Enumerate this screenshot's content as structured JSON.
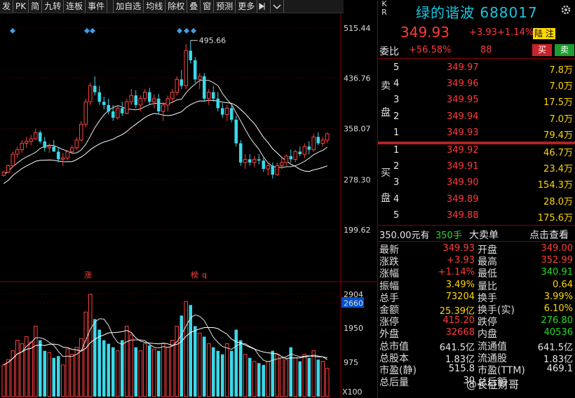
{
  "toolbar": {
    "items": [
      "发",
      "PK",
      "简",
      "九转",
      "连板",
      "事件",
      "加自选",
      "均线",
      "除权",
      "叠",
      "窗",
      "预测",
      "更多"
    ]
  },
  "stock": {
    "kr_top": "K",
    "kr_bottom": "R",
    "name": "绿的谐波",
    "code": "688017",
    "price": "349.93",
    "change": "+3.93",
    "change_pct": "+1.14%",
    "badge1": "陆",
    "badge2": "注",
    "webi_label": "委比",
    "webi_value": "+56.58%",
    "webi_diff": "88",
    "sell_btn": "买",
    "buy_btn": "卖"
  },
  "asks": [
    {
      "level": "5",
      "price": "349.97",
      "vol": "7.8万"
    },
    {
      "level": "4",
      "price": "349.96",
      "vol": "7.0万"
    },
    {
      "level": "3",
      "price": "349.95",
      "vol": "17.5万"
    },
    {
      "level": "2",
      "price": "349.94",
      "vol": "7.0万"
    },
    {
      "level": "1",
      "price": "349.93",
      "vol": "79.4万"
    }
  ],
  "bids": [
    {
      "level": "1",
      "price": "349.92",
      "vol": "46.7万"
    },
    {
      "level": "2",
      "price": "349.91",
      "vol": "23.4万"
    },
    {
      "level": "3",
      "price": "349.90",
      "vol": "154.3万"
    },
    {
      "level": "4",
      "price": "349.89",
      "vol": "28.0万"
    },
    {
      "level": "5",
      "price": "349.88",
      "vol": "175.6万"
    }
  ],
  "side_labels": {
    "sell": [
      "卖",
      "盘"
    ],
    "buy": [
      "买",
      "盘"
    ]
  },
  "big_order": {
    "price": "350.00元有",
    "qty": "350手",
    "label": "大卖单",
    "link": "点击查看"
  },
  "quote": [
    {
      "l1": "最新",
      "v1": "349.93",
      "c1": "red",
      "l2": "开盘",
      "v2": "349.00",
      "c2": "red"
    },
    {
      "l1": "涨跌",
      "v1": "+3.93",
      "c1": "red",
      "l2": "最高",
      "v2": "352.99",
      "c2": "red"
    },
    {
      "l1": "涨幅",
      "v1": "+1.14%",
      "c1": "red",
      "l2": "最低",
      "v2": "340.91",
      "c2": "grn"
    },
    {
      "l1": "振幅",
      "v1": "3.49%",
      "c1": "yel",
      "l2": "量比",
      "v2": "0.64",
      "c2": "yel"
    },
    {
      "l1": "总手",
      "v1": "73204",
      "c1": "yel",
      "l2": "换手",
      "v2": "3.99%",
      "c2": "yel"
    },
    {
      "l1": "金额",
      "v1": "25.39亿",
      "c1": "yel",
      "l2": "换手(实)",
      "v2": "6.10%",
      "c2": "yel"
    },
    {
      "l1": "涨停",
      "v1": "415.20",
      "c1": "red",
      "l2": "跌停",
      "v2": "276.80",
      "c2": "grn"
    },
    {
      "l1": "外盘",
      "v1": "32668",
      "c1": "red",
      "l2": "内盘",
      "v2": "40536",
      "c2": "grn"
    },
    {
      "l1": "总市值",
      "v1": "641.5亿",
      "c1": "wht",
      "l2": "流通值",
      "v2": "641.5亿",
      "c2": "wht"
    },
    {
      "l1": "总股本",
      "v1": "1.83亿",
      "c1": "wht",
      "l2": "流通股",
      "v2": "1.83亿",
      "c2": "wht"
    },
    {
      "l1": "市盈(静)",
      "v1": "515.8",
      "c1": "wht",
      "l2": "市盈(TTM)",
      "v2": "469.1",
      "c2": "wht"
    },
    {
      "l1": "总后量",
      "v1": "30",
      "c1": "wht",
      "l2": "总后额",
      "v2": "",
      "c2": "wht"
    }
  ],
  "watermark": "@长征财哥",
  "chart_data": [
    {
      "type": "candlestick",
      "yaxis_ticks": [
        "515.44",
        "436.76",
        "358.07",
        "278.30",
        "199.62"
      ],
      "high_label": "495.66",
      "markers": [
        "涨",
        "榜",
        "q"
      ],
      "ylim": [
        199.62,
        515.44
      ],
      "candles": [
        [
          285,
          292,
          283,
          290
        ],
        [
          290,
          302,
          288,
          300
        ],
        [
          300,
          322,
          298,
          318
        ],
        [
          318,
          330,
          312,
          325
        ],
        [
          325,
          340,
          320,
          335
        ],
        [
          335,
          345,
          328,
          338
        ],
        [
          338,
          348,
          332,
          342
        ],
        [
          342,
          358,
          340,
          352
        ],
        [
          352,
          355,
          335,
          338
        ],
        [
          338,
          345,
          322,
          328
        ],
        [
          328,
          335,
          320,
          330
        ],
        [
          330,
          340,
          326,
          322
        ],
        [
          322,
          328,
          305,
          310
        ],
        [
          310,
          320,
          300,
          312
        ],
        [
          312,
          325,
          308,
          322
        ],
        [
          322,
          332,
          318,
          328
        ],
        [
          328,
          345,
          325,
          340
        ],
        [
          340,
          370,
          338,
          365
        ],
        [
          365,
          405,
          360,
          400
        ],
        [
          400,
          430,
          395,
          425
        ],
        [
          425,
          440,
          410,
          415
        ],
        [
          415,
          425,
          395,
          400
        ],
        [
          400,
          408,
          388,
          395
        ],
        [
          395,
          405,
          380,
          385
        ],
        [
          385,
          395,
          370,
          375
        ],
        [
          375,
          395,
          372,
          390
        ],
        [
          390,
          400,
          378,
          382
        ],
        [
          382,
          405,
          380,
          400
        ],
        [
          400,
          420,
          395,
          410
        ],
        [
          410,
          418,
          390,
          395
        ],
        [
          395,
          410,
          385,
          405
        ],
        [
          405,
          420,
          400,
          415
        ],
        [
          415,
          422,
          395,
          400
        ],
        [
          400,
          412,
          390,
          405
        ],
        [
          405,
          412,
          380,
          385
        ],
        [
          385,
          400,
          370,
          395
        ],
        [
          395,
          410,
          385,
          405
        ],
        [
          405,
          420,
          398,
          415
        ],
        [
          415,
          440,
          410,
          435
        ],
        [
          435,
          450,
          420,
          425
        ],
        [
          425,
          490,
          420,
          480
        ],
        [
          480,
          496,
          460,
          465
        ],
        [
          465,
          470,
          430,
          435
        ],
        [
          435,
          445,
          420,
          440
        ],
        [
          440,
          445,
          400,
          405
        ],
        [
          405,
          420,
          395,
          415
        ],
        [
          415,
          425,
          400,
          405
        ],
        [
          405,
          415,
          385,
          390
        ],
        [
          390,
          398,
          375,
          380
        ],
        [
          380,
          395,
          370,
          390
        ],
        [
          390,
          395,
          368,
          372
        ],
        [
          372,
          378,
          330,
          335
        ],
        [
          335,
          340,
          300,
          305
        ],
        [
          305,
          318,
          295,
          310
        ],
        [
          310,
          318,
          300,
          305
        ],
        [
          305,
          315,
          298,
          310
        ],
        [
          310,
          318,
          302,
          308
        ],
        [
          308,
          312,
          290,
          295
        ],
        [
          295,
          305,
          285,
          300
        ],
        [
          300,
          305,
          280,
          286
        ],
        [
          286,
          305,
          284,
          300
        ],
        [
          300,
          312,
          295,
          305
        ],
        [
          305,
          318,
          300,
          315
        ],
        [
          315,
          325,
          305,
          310
        ],
        [
          310,
          325,
          305,
          322
        ],
        [
          322,
          330,
          315,
          318
        ],
        [
          318,
          335,
          312,
          330
        ],
        [
          330,
          338,
          318,
          325
        ],
        [
          325,
          350,
          322,
          345
        ],
        [
          345,
          352,
          332,
          335
        ],
        [
          335,
          345,
          330,
          340
        ],
        [
          340,
          352,
          335,
          349.93
        ]
      ]
    },
    {
      "type": "bar",
      "yaxis_ticks": [
        "2904",
        "2660",
        "1950",
        "975"
      ],
      "unit_label": "X100",
      "ylim": [
        0,
        2904
      ],
      "values": [
        900,
        1050,
        1300,
        1600,
        1500,
        1700,
        1550,
        2000,
        1600,
        1300,
        1250,
        1100,
        1150,
        900,
        1350,
        1200,
        1400,
        1650,
        2400,
        2904,
        2200,
        1900,
        1600,
        1500,
        1400,
        1300,
        1600,
        2000,
        1750,
        1400,
        1300,
        1500,
        1450,
        1350,
        1300,
        1500,
        1400,
        1600,
        2000,
        2300,
        2700,
        2600,
        2000,
        1800,
        1700,
        1500,
        1400,
        1300,
        1200,
        1500,
        1300,
        1900,
        1600,
        1200,
        1100,
        1000,
        950,
        900,
        1000,
        1300,
        1200,
        1100,
        1050,
        1400,
        1100,
        1000,
        1200,
        1100,
        1300,
        1050,
        1000,
        800
      ]
    }
  ]
}
